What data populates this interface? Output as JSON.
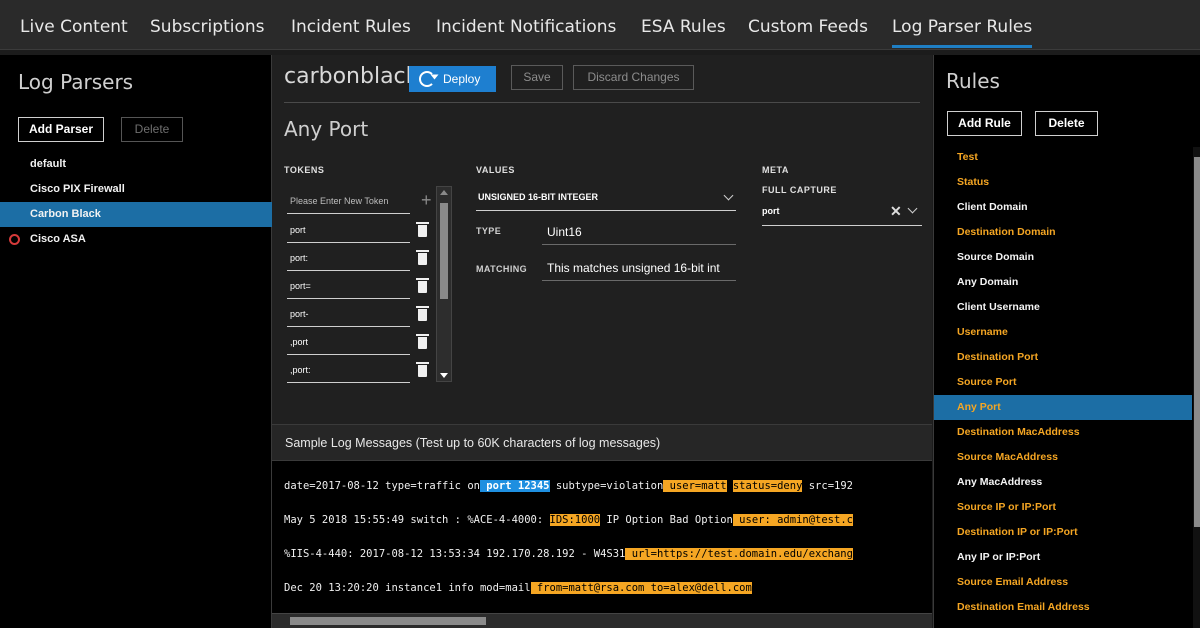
{
  "topnav": {
    "tabs": [
      {
        "label": "Live Content"
      },
      {
        "label": "Subscriptions"
      },
      {
        "label": "Incident Rules"
      },
      {
        "label": "Incident Notifications"
      },
      {
        "label": "ESA Rules"
      },
      {
        "label": "Custom Feeds"
      },
      {
        "label": "Log Parser Rules"
      }
    ]
  },
  "left": {
    "title": "Log Parsers",
    "add_label": "Add Parser",
    "delete_label": "Delete",
    "parsers": [
      {
        "label": "default"
      },
      {
        "label": "Cisco PIX Firewall"
      },
      {
        "label": "Carbon Black"
      },
      {
        "label": "Cisco ASA"
      }
    ]
  },
  "editor": {
    "parser_name": "carbonblack",
    "deploy_label": "Deploy",
    "save_label": "Save",
    "discard_label": "Discard Changes",
    "rule_title": "Any Port",
    "tokens_head": "TOKENS",
    "values_head": "VALUES",
    "meta_head": "META",
    "token_placeholder": "Please Enter New Token",
    "tokens": [
      "port",
      "port:",
      "port=",
      "port-",
      ",port",
      ",port:"
    ],
    "value_type_select": "UNSIGNED 16-BIT INTEGER",
    "type_label": "TYPE",
    "type_value": "Uint16",
    "matching_label": "MATCHING",
    "matching_value": "This matches unsigned 16-bit int",
    "full_capture_label": "FULL CAPTURE",
    "full_capture_value": "port",
    "full_capture_clear": "✕"
  },
  "samples": {
    "heading": "Sample Log Messages (Test up to 60K characters of log messages)",
    "line1": {
      "a": "date=2017-08-12 type=traffic on",
      "b": " port 12345",
      "c": " subtype=violation",
      "d": " user=matt",
      "e": " ",
      "f": "status=deny",
      "g": " src=192"
    },
    "line2": {
      "a": "May 5 2018 15:55:49 switch : %ACE-4-4000: ",
      "b": "IDS:1000",
      "c": " IP Option Bad Option",
      "d": " user: admin@test.c"
    },
    "line3": {
      "a": "%IIS-4-440: 2017-08-12 13:53:34 192.170.28.192 - W4S31",
      "b": " url=https://test.domain.edu/exchang"
    },
    "line4": {
      "a": "Dec 20 13:20:20 instance1 info mod=mail",
      "b": " from=matt@rsa.com to=alex@dell.com"
    }
  },
  "right": {
    "title": "Rules",
    "add_label": "Add Rule",
    "delete_label": "Delete",
    "rules": [
      {
        "label": "Test"
      },
      {
        "label": "Status"
      },
      {
        "label": "Client Domain"
      },
      {
        "label": "Destination Domain"
      },
      {
        "label": "Source Domain"
      },
      {
        "label": "Any Domain"
      },
      {
        "label": "Client Username"
      },
      {
        "label": "Username"
      },
      {
        "label": "Destination Port"
      },
      {
        "label": "Source Port"
      },
      {
        "label": "Any Port"
      },
      {
        "label": "Destination MacAddress"
      },
      {
        "label": "Source MacAddress"
      },
      {
        "label": "Any MacAddress"
      },
      {
        "label": "Source IP or IP:Port"
      },
      {
        "label": "Destination IP or IP:Port"
      },
      {
        "label": "Any IP or IP:Port"
      },
      {
        "label": "Source Email Address"
      },
      {
        "label": "Destination Email Address"
      }
    ]
  },
  "colors": {
    "accent": "#1f7fc4",
    "highlight": "#f5a623",
    "selected_row": "#1c6ea5"
  }
}
